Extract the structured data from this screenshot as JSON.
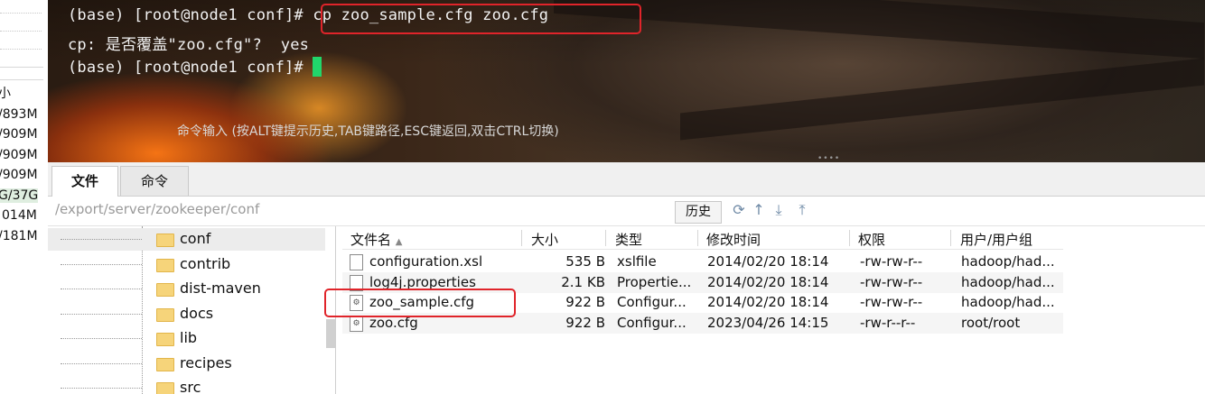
{
  "left_panel": {
    "header_glyph": "小",
    "values": [
      "/893M",
      "/909M",
      "/909M",
      "/909M",
      "G/37G",
      "014M",
      "/181M"
    ]
  },
  "terminal": {
    "prompt": "(base) [root@node1 conf]#",
    "command": "cp zoo_sample.cfg zoo.cfg",
    "output_line": "cp: 是否覆盖\"zoo.cfg\"?  yes",
    "hint": "命令输入 (按ALT键提示历史,TAB键路径,ESC键返回,双击CTRL切换)",
    "highlight_color": "#e0242a",
    "cursor_color": "#21d66b"
  },
  "tabs": [
    {
      "label": "文件",
      "active": true
    },
    {
      "label": "命令",
      "active": false
    }
  ],
  "path_bar": {
    "path": "/export/server/zookeeper/conf",
    "history_label": "历史",
    "icons": [
      "refresh-icon",
      "up-arrow-icon",
      "download-icon",
      "upload-icon"
    ]
  },
  "tree": {
    "items": [
      {
        "label": "conf",
        "selected": true
      },
      {
        "label": "contrib",
        "selected": false
      },
      {
        "label": "dist-maven",
        "selected": false
      },
      {
        "label": "docs",
        "selected": false
      },
      {
        "label": "lib",
        "selected": false
      },
      {
        "label": "recipes",
        "selected": false
      },
      {
        "label": "src",
        "selected": false
      }
    ]
  },
  "file_list": {
    "columns": {
      "name": "文件名",
      "size": "大小",
      "type": "类型",
      "modified": "修改时间",
      "permissions": "权限",
      "owner": "用户/用户组"
    },
    "sort_indicator": "▲",
    "rows": [
      {
        "name": "configuration.xsl",
        "size": "535 B",
        "type": "xslfile",
        "modified": "2014/02/20 18:14",
        "permissions": "-rw-rw-r--",
        "owner": "hadoop/had..."
      },
      {
        "name": "log4j.properties",
        "size": "2.1 KB",
        "type": "Propertie...",
        "modified": "2014/02/20 18:14",
        "permissions": "-rw-rw-r--",
        "owner": "hadoop/had..."
      },
      {
        "name": "zoo_sample.cfg",
        "size": "922 B",
        "type": "Configur...",
        "modified": "2014/02/20 18:14",
        "permissions": "-rw-rw-r--",
        "owner": "hadoop/had..."
      },
      {
        "name": "zoo.cfg",
        "size": "922 B",
        "type": "Configur...",
        "modified": "2023/04/26 14:15",
        "permissions": "-rw-r--r--",
        "owner": "root/root"
      }
    ]
  }
}
